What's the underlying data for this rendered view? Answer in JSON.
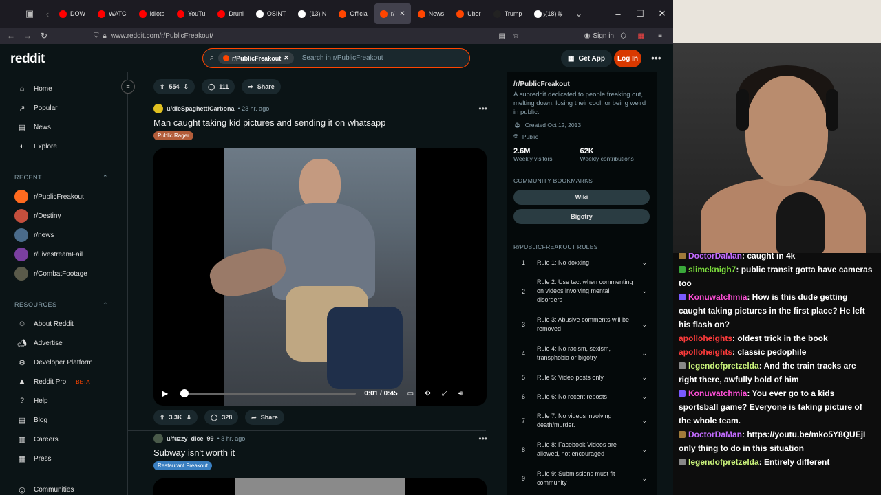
{
  "browser": {
    "tabs": [
      {
        "label": "DOW",
        "color": "#ff0000"
      },
      {
        "label": "WATC",
        "color": "#ff0000"
      },
      {
        "label": "Idiots",
        "color": "#ff0000"
      },
      {
        "label": "YouTu",
        "color": "#ff0000"
      },
      {
        "label": "Drunl",
        "color": "#ff0000"
      },
      {
        "label": "OSINT",
        "color": "#ffffff"
      },
      {
        "label": "(13) N",
        "color": "#ffffff"
      },
      {
        "label": "Officia",
        "color": "#ff4500"
      },
      {
        "label": "r/",
        "color": "#ff4500"
      },
      {
        "label": "News",
        "color": "#ff4500"
      },
      {
        "label": "Uber",
        "color": "#ff4500"
      },
      {
        "label": "Trump",
        "color": "#222222"
      },
      {
        "label": "(18) N",
        "color": "#ffffff"
      }
    ],
    "url": "www.reddit.com/r/PublicFreakout/",
    "signin": "Sign in"
  },
  "reddit": {
    "logo": "reddit",
    "search_chip": "r/PublicFreakout",
    "search_placeholder": "Search in r/PublicFreakout",
    "get_app": "Get App",
    "login": "Log In"
  },
  "sidebar": {
    "nav": [
      {
        "label": "Home",
        "icon": "home-icon"
      },
      {
        "label": "Popular",
        "icon": "popular-icon"
      },
      {
        "label": "News",
        "icon": "news-icon"
      },
      {
        "label": "Explore",
        "icon": "explore-icon"
      }
    ],
    "recent_label": "RECENT",
    "recent": [
      {
        "label": "r/PublicFreakout",
        "color": "#ff6a1f"
      },
      {
        "label": "r/Destiny",
        "color": "#c44f3d"
      },
      {
        "label": "r/news",
        "color": "#4a6b8a"
      },
      {
        "label": "r/LivestreamFail",
        "color": "#7a3fa0"
      },
      {
        "label": "r/CombatFootage",
        "color": "#5a5a4a"
      }
    ],
    "resources_label": "RESOURCES",
    "resources": [
      {
        "label": "About Reddit"
      },
      {
        "label": "Advertise"
      },
      {
        "label": "Developer Platform"
      },
      {
        "label": "Reddit Pro",
        "badge": "BETA"
      },
      {
        "label": "Help"
      },
      {
        "label": "Blog"
      },
      {
        "label": "Careers"
      },
      {
        "label": "Press"
      }
    ],
    "communities": "Communities"
  },
  "feed": {
    "top_actions": {
      "votes": "554",
      "comments": "111",
      "share": "Share"
    },
    "post1": {
      "user": "u/dieSpaghettiCarbona",
      "time": "• 23 hr. ago",
      "title": "Man caught taking kid pictures and sending it on whatsapp",
      "flair": "Public Rager",
      "video_time": "0:01 / 0:45",
      "progress": 0.022,
      "votes": "3.3K",
      "comments": "328",
      "share": "Share"
    },
    "post2": {
      "user": "u/fuzzy_dice_99",
      "time": "• 3 hr. ago",
      "title": "Subway isn't worth it",
      "flair": "Restaurant Freakout"
    }
  },
  "about": {
    "title": "/r/PublicFreakout",
    "desc": "A subreddit dedicated to people freaking out, melting down, losing their cool, or being weird in public.",
    "created": "Created Oct 12, 2013",
    "visibility": "Public",
    "visitors": "2.6M",
    "visitors_label": "Weekly visitors",
    "contrib": "62K",
    "contrib_label": "Weekly contributions",
    "bookmarks_label": "COMMUNITY BOOKMARKS",
    "bookmarks": [
      "Wiki",
      "Bigotry"
    ],
    "rules_label": "R/PUBLICFREAKOUT RULES",
    "rules": [
      {
        "n": "1",
        "text": "Rule 1: No doxxing",
        "h": 28
      },
      {
        "n": "2",
        "text": "Rule 2: Use tact when commenting on videos involving mental disorders",
        "h": 55
      },
      {
        "n": "3",
        "text": "Rule 3: Abusive comments will be removed",
        "h": 42
      },
      {
        "n": "4",
        "text": "Rule 4: No racism, sexism, transphobia or bigotry",
        "h": 42
      },
      {
        "n": "5",
        "text": "Rule 5: Video posts only",
        "h": 28
      },
      {
        "n": "6",
        "text": "Rule 6: No recent reposts",
        "h": 28
      },
      {
        "n": "7",
        "text": "Rule 7: No videos involving death/murder.",
        "h": 42
      },
      {
        "n": "8",
        "text": "Rule 8: Facebook Videos are allowed, not encouraged",
        "h": 42
      },
      {
        "n": "9",
        "text": "Rule 9: Submissions must fit community",
        "h": 42
      }
    ]
  },
  "chat": [
    {
      "user": "DoctorDaMan",
      "color": "#c36bff",
      "badge": "#a07a3a",
      "text": ": caught in 4k"
    },
    {
      "user": "slimeknigh7",
      "color": "#7bdc3c",
      "badge": "#3aa83a",
      "text": ": public transit gotta have cameras too"
    },
    {
      "user": "Konuwatchmia",
      "color": "#ff4fd8",
      "badge": "#7a5aff",
      "text": ": How is this dude getting caught taking pictures in the first place? He left his flash on?"
    },
    {
      "user": "apolloheights",
      "color": "#ff3b3b",
      "badge": "",
      "text": ": oldest trick in the book"
    },
    {
      "user": "apolloheights",
      "color": "#ff3b3b",
      "badge": "",
      "text": ": classic pedophile"
    },
    {
      "user": "legendofpretzelda",
      "color": "#c9f27a",
      "badge": "#888888",
      "text": ": And the train tracks are right there, awfully bold of him"
    },
    {
      "user": "Konuwatchmia",
      "color": "#ff4fd8",
      "badge": "#7a5aff",
      "text": ": You ever go to a kids sportsball game? Everyone is taking picture of the whole team."
    },
    {
      "user": "DoctorDaMan",
      "color": "#c36bff",
      "badge": "#a07a3a",
      "text": ": https://youtu.be/mko5Y8QUEjI only thing to do in this situation"
    },
    {
      "user": "legendofpretzelda",
      "color": "#c9f27a",
      "badge": "#888888",
      "text": ": Entirely different"
    }
  ]
}
